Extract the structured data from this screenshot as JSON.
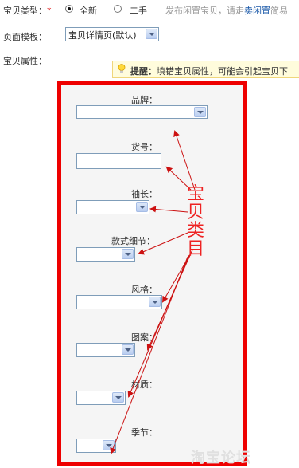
{
  "item_type": {
    "label": "宝贝类型：",
    "required_mark": "*",
    "option_new": "全新",
    "option_used": "二手",
    "hint_prefix": "发布闲置宝贝，请走",
    "hint_link": "卖闲置",
    "hint_suffix": "简易"
  },
  "template": {
    "label": "页面模板：",
    "selected": "宝贝详情页(默认)"
  },
  "attributes": {
    "label": "宝贝属性：",
    "tip_title": "提醒：",
    "tip_text": "填错宝贝属性，可能会引起宝贝下",
    "fields": {
      "brand": "品牌：",
      "sku": "货号：",
      "sleeve": "袖长：",
      "detail": "款式细节：",
      "style": "风格：",
      "pattern": "图案：",
      "material": "材质：",
      "season": "季节："
    }
  },
  "annotation": {
    "chars": [
      "宝",
      "贝",
      "类",
      "目"
    ]
  },
  "watermark": "淘宝论坛",
  "colors": {
    "highlight_border": "#ee0000",
    "annotation": "#ee2222",
    "link": "#1a58a8"
  }
}
